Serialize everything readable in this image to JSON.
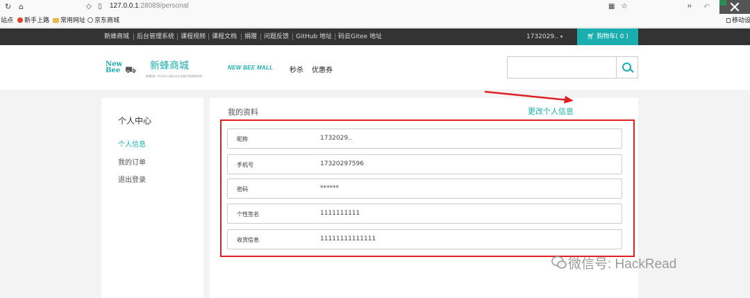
{
  "browser": {
    "url_host": "127.0.0.1",
    "url_rest": ":28089/personal",
    "bookmarks": [
      {
        "label": "站点"
      },
      {
        "label": "新手上路"
      },
      {
        "label": "常用网址"
      },
      {
        "label": "京东商城"
      }
    ],
    "mobile_bookmark": "移动设备"
  },
  "topnav": {
    "links": [
      "新蜂商城",
      "后台管理系统",
      "课程视频",
      "课程文档",
      "捐赠",
      "问题反馈",
      "GitHub 地址",
      "码云Gitee 地址"
    ],
    "user": "1732029..",
    "cart": "购物车( 0 )"
  },
  "header": {
    "logo_new": "New",
    "logo_bee": "Bee",
    "logo_title": "新蜂商城",
    "logo_sub": "新蜂(新一代)SpringBoot企业级开源商城系统",
    "mall_tag": "NEW BEE MALL",
    "nav": [
      "秒杀",
      "优惠券"
    ],
    "search_placeholder": ""
  },
  "sidebar": {
    "title": "个人中心",
    "items": [
      {
        "label": "个人信息",
        "active": true
      },
      {
        "label": "我的订单",
        "active": false
      },
      {
        "label": "退出登录",
        "active": false
      }
    ]
  },
  "profile": {
    "title": "我的资料",
    "edit_label": "更改个人信息",
    "fields": [
      {
        "label": "昵称",
        "value": "1732029.."
      },
      {
        "label": "手机号",
        "value": "17320297596"
      },
      {
        "label": "密码",
        "value": "******"
      },
      {
        "label": "个性签名",
        "value": "1111111111"
      },
      {
        "label": "收货信息",
        "value": "11111111111111"
      }
    ]
  },
  "watermark": "微信号: HackRead",
  "colors": {
    "accent": "#1baeae",
    "topbar": "#333333",
    "annotation": "#e02020"
  }
}
